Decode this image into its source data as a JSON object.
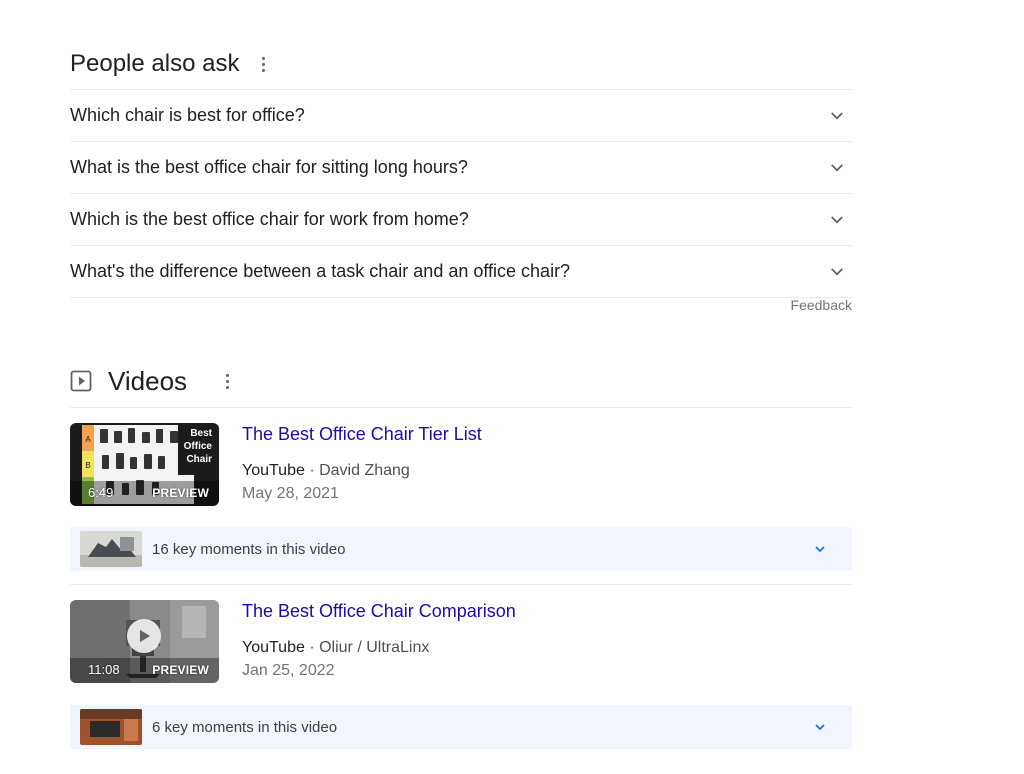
{
  "paa": {
    "title": "People also ask",
    "questions": [
      "Which chair is best for office?",
      "What is the best office chair for sitting long hours?",
      "Which is the best office chair for work from home?",
      "What's the difference between a task chair and an office chair?"
    ],
    "feedback": "Feedback"
  },
  "videos": {
    "title": "Videos",
    "items": [
      {
        "title": "The Best Office Chair Tier List",
        "source": "YouTube",
        "author": "David Zhang",
        "date": "May 28, 2021",
        "duration": "6:49",
        "preview": "PREVIEW",
        "thumb_text": [
          "Best",
          "Office",
          "Chair"
        ],
        "tier_labels": [
          "A",
          "B"
        ],
        "key_moments": "16 key moments in this video"
      },
      {
        "title": "The Best Office Chair Comparison",
        "source": "YouTube",
        "author": "Oliur / UltraLinx",
        "date": "Jan 25, 2022",
        "duration": "11:08",
        "preview": "PREVIEW",
        "key_moments": "6 key moments in this video"
      }
    ],
    "separator": " · "
  },
  "colors": {
    "link": "#1a0dab",
    "key_moments_bg": "#f1f5fd",
    "accent_chevron": "#1a73e8"
  },
  "icons": {
    "menu": "kebab-menu-icon",
    "expand": "chevron-down-icon",
    "video_section": "play-box-icon",
    "play": "play-circle-icon"
  }
}
